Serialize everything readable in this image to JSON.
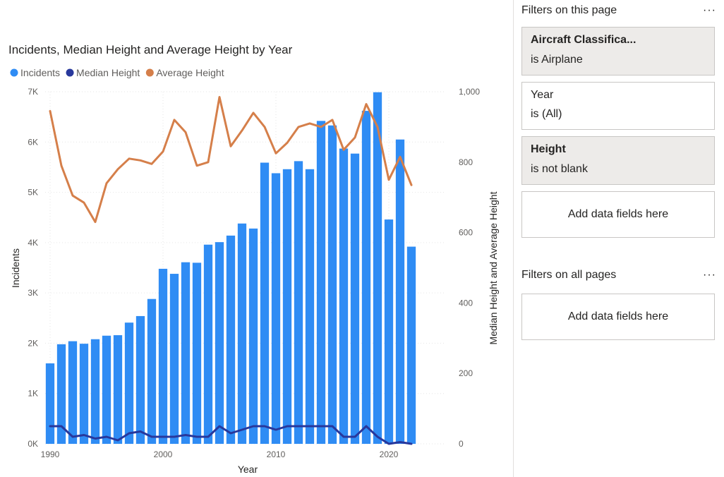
{
  "chart_data": {
    "type": "bar+line",
    "title": "Incidents, Median Height and Average Height by Year",
    "xlabel": "Year",
    "ylabel": "Incidents",
    "y2label": "Median Height and Average Height",
    "ylim": [
      0,
      7000
    ],
    "y2lim": [
      0,
      1000
    ],
    "xlim": [
      1990,
      2022
    ],
    "yticks": [
      "0K",
      "1K",
      "2K",
      "3K",
      "4K",
      "5K",
      "6K",
      "7K"
    ],
    "y2ticks": [
      "0",
      "200",
      "400",
      "600",
      "800",
      "1,000"
    ],
    "xticks": [
      "1990",
      "2000",
      "2010",
      "2020"
    ],
    "grid": true,
    "legend_position": "top-left",
    "x": [
      1990,
      1991,
      1992,
      1993,
      1994,
      1995,
      1996,
      1997,
      1998,
      1999,
      2000,
      2001,
      2002,
      2003,
      2004,
      2005,
      2006,
      2007,
      2008,
      2009,
      2010,
      2011,
      2012,
      2013,
      2014,
      2015,
      2016,
      2017,
      2018,
      2019,
      2020,
      2021,
      2022
    ],
    "series": [
      {
        "name": "Incidents",
        "type": "bar",
        "axis": "left",
        "color": "#2f8cf4",
        "values": [
          1600,
          1980,
          2040,
          1990,
          2080,
          2150,
          2160,
          2410,
          2540,
          2880,
          3480,
          3380,
          3610,
          3600,
          3960,
          4010,
          4140,
          4380,
          4280,
          5590,
          5380,
          5460,
          5620,
          5460,
          6420,
          6330,
          5870,
          5770,
          6620,
          6990,
          4460,
          6050,
          3920
        ]
      },
      {
        "name": "Median Height",
        "type": "line",
        "axis": "right",
        "color": "#28389c",
        "values": [
          50,
          50,
          20,
          25,
          15,
          20,
          10,
          30,
          35,
          20,
          20,
          20,
          25,
          20,
          20,
          50,
          30,
          40,
          50,
          50,
          40,
          50,
          50,
          50,
          50,
          50,
          20,
          20,
          50,
          20,
          0,
          5,
          0
        ]
      },
      {
        "name": "Average Height",
        "type": "line",
        "axis": "right",
        "color": "#d57f4a",
        "values": [
          945,
          790,
          705,
          685,
          630,
          740,
          780,
          810,
          805,
          795,
          830,
          920,
          885,
          790,
          800,
          985,
          845,
          890,
          940,
          900,
          825,
          855,
          900,
          910,
          900,
          920,
          835,
          870,
          965,
          900,
          750,
          815,
          735
        ]
      }
    ]
  },
  "filters": {
    "page_header": "Filters on this page",
    "all_header": "Filters on all pages",
    "more_label": "···",
    "cards": [
      {
        "title": "Aircraft Classifica...",
        "subtitle": "is Airplane"
      },
      {
        "title": "Year",
        "subtitle": "is (All)"
      },
      {
        "title": "Height",
        "subtitle": "is not blank"
      }
    ],
    "add_fields_label": "Add data fields here"
  }
}
